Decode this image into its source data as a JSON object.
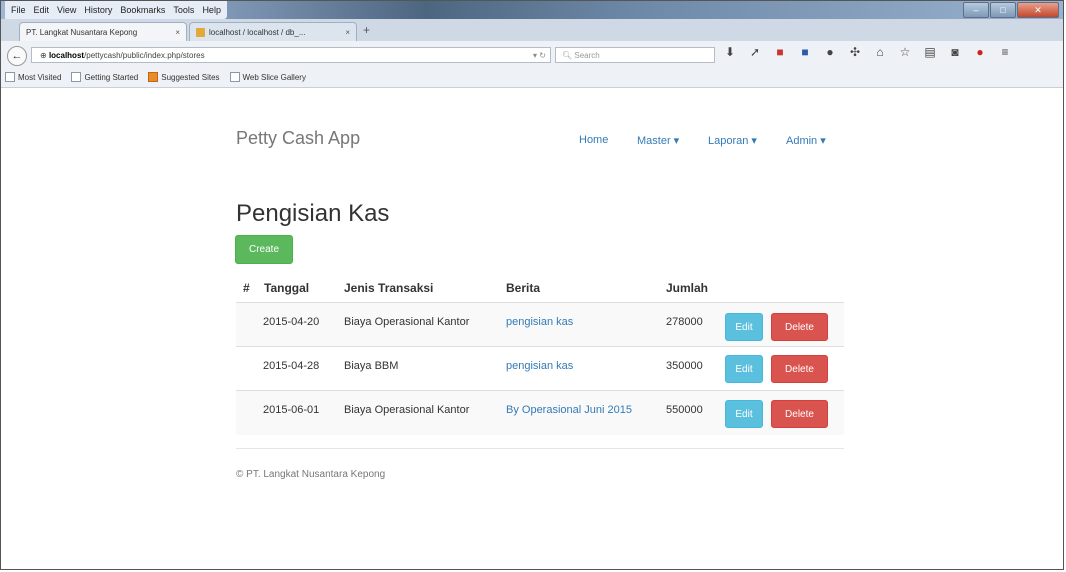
{
  "browser": {
    "menu": [
      "File",
      "Edit",
      "View",
      "History",
      "Bookmarks",
      "Tools",
      "Help"
    ],
    "tabs": [
      {
        "label": "PT. Langkat Nusantara Kepong",
        "close": "×"
      },
      {
        "label": "localhost / localhost / db_...",
        "close": "×"
      }
    ],
    "new_tab": "+",
    "url": {
      "host": "localhost",
      "path": "/pettycash/public/index.php/stores"
    },
    "search_placeholder": "Search",
    "bookmarks": [
      "Most Visited",
      "Getting Started",
      "Suggested Sites",
      "Web Slice Gallery"
    ]
  },
  "app": {
    "brand": "Petty Cash App",
    "nav": {
      "home": "Home",
      "master": "Master ▾",
      "laporan": "Laporan ▾",
      "admin": "Admin ▾"
    },
    "page_title": "Pengisian Kas",
    "create_label": "Create",
    "table": {
      "headers": [
        "#",
        "Tanggal",
        "Jenis Transaksi",
        "Berita",
        "Jumlah"
      ],
      "rows": [
        {
          "tanggal": "2015-04-20",
          "jenis": "Biaya Operasional Kantor",
          "berita": "pengisian kas",
          "jumlah": "278000"
        },
        {
          "tanggal": "2015-04-28",
          "jenis": "Biaya BBM",
          "berita": "pengisian kas",
          "jumlah": "350000"
        },
        {
          "tanggal": "2015-06-01",
          "jenis": "Biaya Operasional Kantor",
          "berita": "By Operasional Juni 2015",
          "jumlah": "550000"
        }
      ],
      "edit_label": "Edit",
      "delete_label": "Delete"
    },
    "footer": "© PT. Langkat Nusantara Kepong"
  },
  "colors": {
    "link": "#337ab7",
    "create": "#5cb85c",
    "edit": "#5bc0de",
    "delete": "#d9534f"
  }
}
